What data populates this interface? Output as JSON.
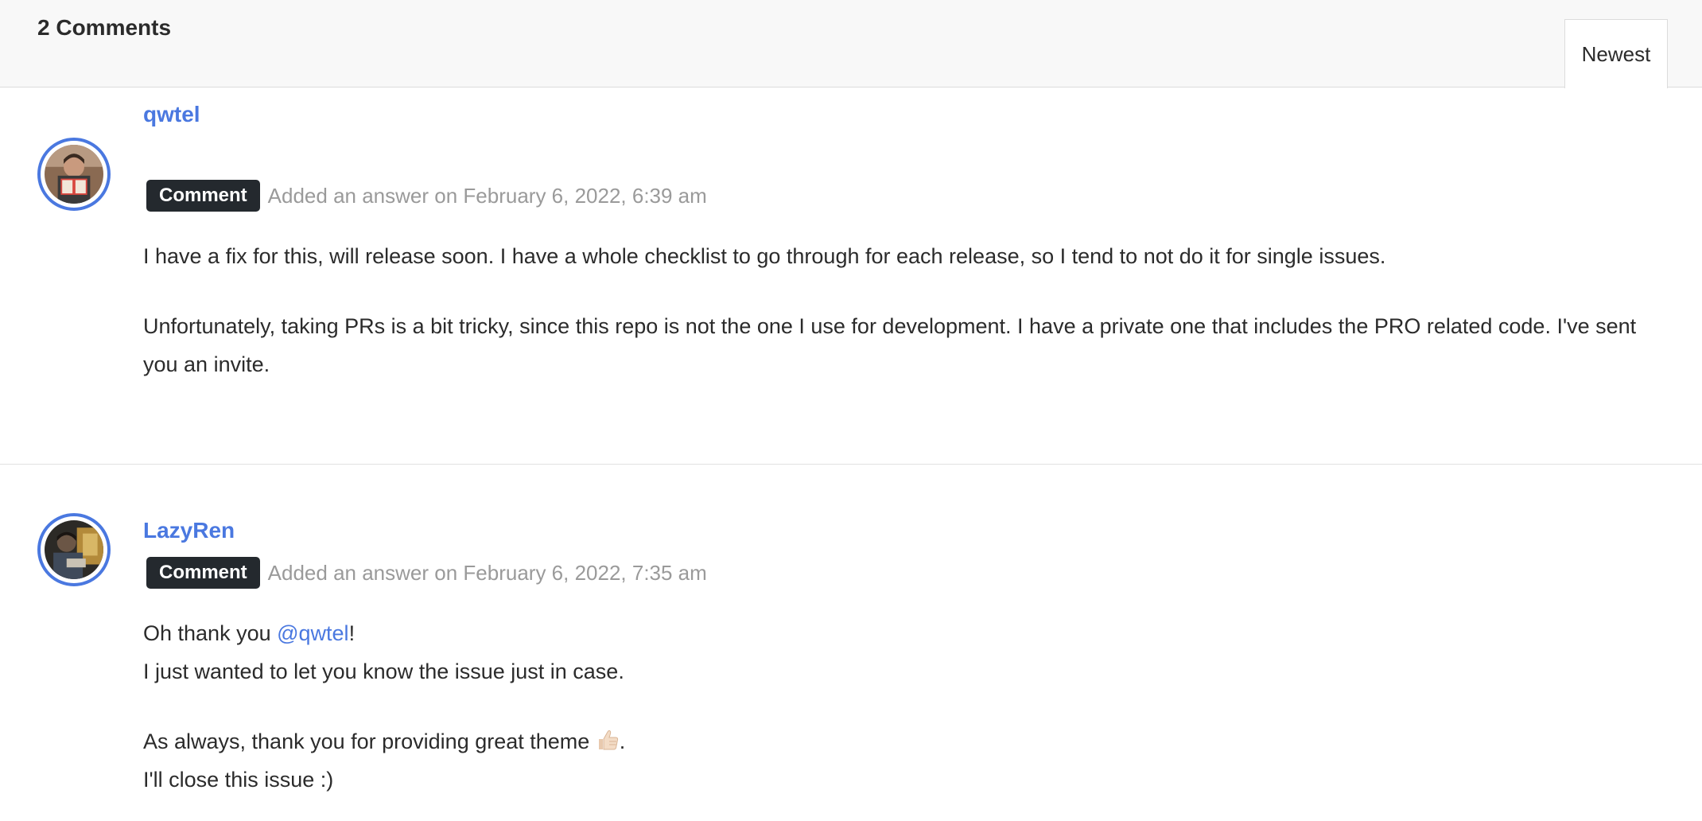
{
  "header": {
    "comment_count": "2 Comments",
    "sort_label": "Newest"
  },
  "comments": [
    {
      "author": "qwtel",
      "badge": "Comment",
      "meta": "Added an answer on February 6, 2022, 6:39 am",
      "paragraphs": [
        "I have a fix for this, will release soon. I have a whole checklist to go through for each release, so I tend to not do it for single issues.",
        "Unfortunately, taking PRs is a bit tricky, since this repo is not the one I use for development. I have a private one that includes the PRO related code. I've sent you an invite."
      ]
    },
    {
      "author": "LazyRen",
      "badge": "Comment",
      "meta": "Added an answer on February 6, 2022, 7:35 am",
      "line1_before": "Oh thank you ",
      "mention": "@qwtel",
      "line1_after": "!",
      "line2": "I just wanted to let you know the issue just in case.",
      "line3_before": "As always, thank you for providing great theme ",
      "line3_icon": "thumbs-up-icon",
      "line3_after": ".",
      "line4": "I'll close this issue :)"
    }
  ],
  "colors": {
    "accent": "#4a78e0",
    "badge_bg": "#24292e",
    "meta_text": "#9a9a9a",
    "header_bg": "#f8f8f8"
  }
}
